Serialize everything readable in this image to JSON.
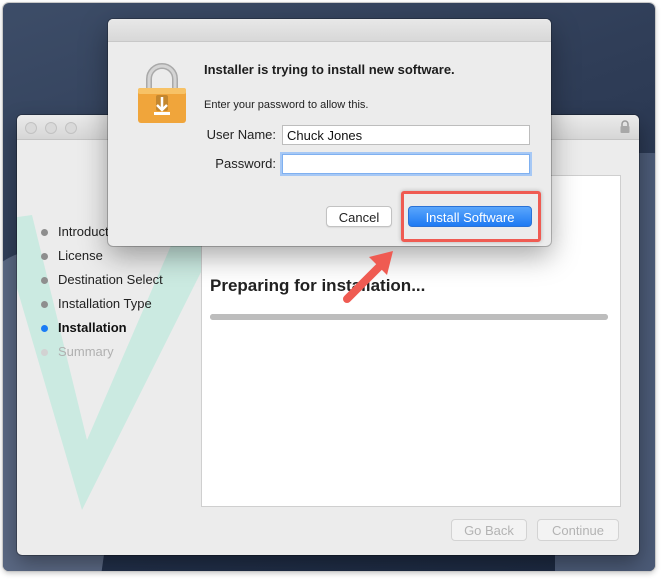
{
  "installer": {
    "steps": [
      {
        "label": "Introduction",
        "state": "done"
      },
      {
        "label": "License",
        "state": "done"
      },
      {
        "label": "Destination Select",
        "state": "done"
      },
      {
        "label": "Installation Type",
        "state": "done"
      },
      {
        "label": "Installation",
        "state": "active"
      },
      {
        "label": "Summary",
        "state": "future"
      }
    ],
    "status_text": "Preparing for installation...",
    "progress_fraction": 1.0,
    "go_back_label": "Go Back",
    "continue_label": "Continue"
  },
  "dialog": {
    "heading": "Installer is trying to install new software.",
    "subtext": "Enter your password to allow this.",
    "username_label": "User Name:",
    "username_value": "Chuck Jones",
    "password_label": "Password:",
    "password_value": "",
    "cancel_label": "Cancel",
    "install_label": "Install Software"
  },
  "colors": {
    "accent_blue": "#1e7af3",
    "annotation_red": "#ef5b52",
    "active_step": "#1a7cf5"
  },
  "icons": {
    "dialog_icon": "padlock-icon",
    "window_lock": "lock-icon"
  }
}
